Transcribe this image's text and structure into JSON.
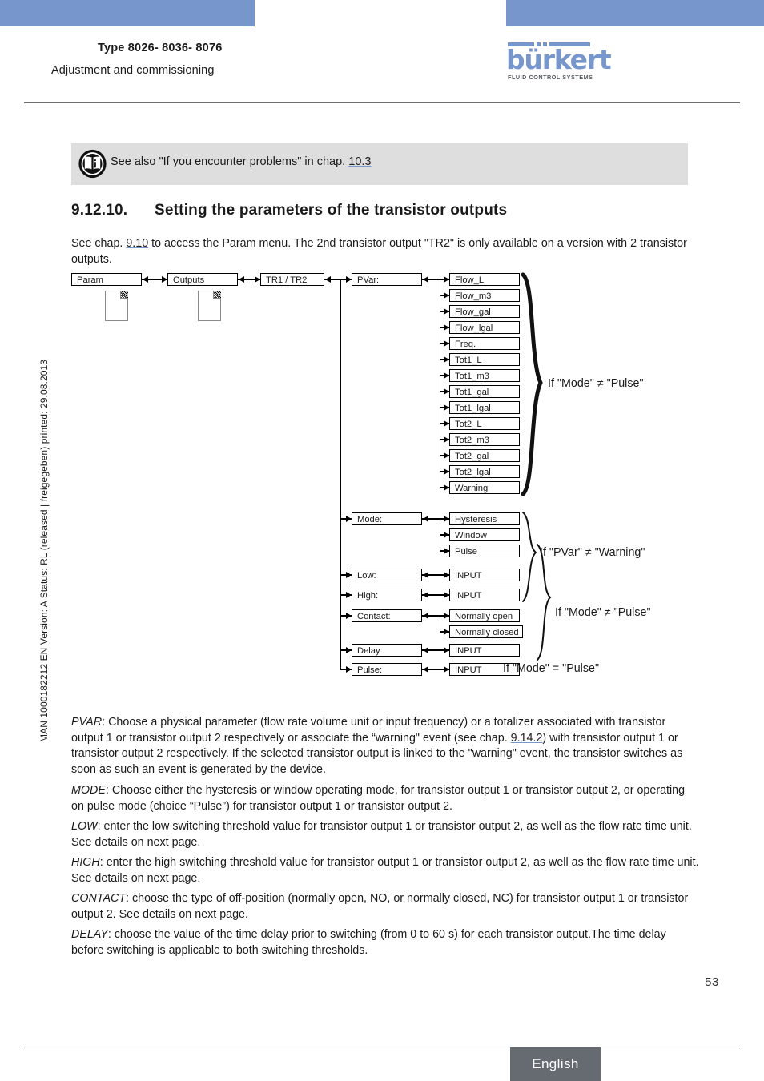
{
  "header": {
    "type_line": "Type 8026- 8036- 8076",
    "subtitle": "Adjustment and commissioning",
    "logo_word": "bürkert",
    "logo_tagline": "FLUID CONTROL SYSTEMS",
    "brand_color": "#7796cc"
  },
  "sidenote": "MAN 1000182212  EN  Version: A  Status: RL (released | freigegeben)  printed: 29.08.2013",
  "note": {
    "icon": "book-info-icon",
    "text_before": "See also \"If you encounter problems\" in chap. ",
    "link": "10.3"
  },
  "heading": {
    "number": "9.12.10.",
    "title": "Setting the parameters of the transistor outputs"
  },
  "intro": {
    "part1": "See chap. ",
    "link": "9.10",
    "part2": " to access the Param menu. The 2nd transistor output \"TR2\" is only available on a version with 2 transistor outputs."
  },
  "diagram": {
    "menu_path": [
      {
        "label": "Param"
      },
      {
        "label": "Outputs"
      },
      {
        "label": "TR1 / TR2"
      }
    ],
    "page_icons": [
      "page-icon-param",
      "page-icon-outputs"
    ],
    "params": [
      {
        "label": "PVar:"
      },
      {
        "label": "Mode:"
      },
      {
        "label": "Low:"
      },
      {
        "label": "High:"
      },
      {
        "label": "Contact:"
      },
      {
        "label": "Delay:"
      },
      {
        "label": "Pulse:"
      }
    ],
    "pvar_options": [
      "Flow_L",
      "Flow_m3",
      "Flow_gal",
      "Flow_lgal",
      "Freq.",
      "Tot1_L",
      "Tot1_m3",
      "Tot1_gal",
      "Tot1_lgal",
      "Tot2_L",
      "Tot2_m3",
      "Tot2_gal",
      "Tot2_lgal",
      "Warning"
    ],
    "mode_options": [
      "Hysteresis",
      "Window",
      "Pulse"
    ],
    "low_option": "INPUT",
    "high_option": "INPUT",
    "contact_options": [
      "Normally open",
      "Normally closed"
    ],
    "delay_option": "INPUT",
    "pulse_option": "INPUT",
    "conditions": {
      "pvar_brace": "If \"Mode\" ≠ \"Pulse\"",
      "mode_brace": "If \"PVar\" ≠ \"Warning\"",
      "group_brace": "If \"Mode\" ≠ \"Pulse\"",
      "pulse_label": "If \"Mode\" = \"Pulse\""
    }
  },
  "body": {
    "pvar": "PVAR: Choose a physical parameter (flow rate volume unit or input frequency) or a totalizer associated with transistor output 1 or transistor output 2 respectively or associate the “warning\" event (see chap. 9.14.2) with transistor output 1 or transistor output 2 respectively. If the selected transistor output is linked to the \"warning\" event, the transistor switches as soon as such an event is generated by the device.",
    "pvar_label": "PVAR",
    "pvar_t1": ": Choose a physical parameter (flow rate volume unit or input frequency) or a totalizer associated with transistor output 1 or transistor output 2 respectively or associate the “warning\" event (see chap. ",
    "pvar_link": "9.14.2",
    "pvar_t2": ") with transistor output 1 or transistor output 2 respectively. If the selected transistor output is linked to the \"warning\" event, the transistor switches as soon as such an event is generated by the device.",
    "mode_label": "MODE",
    "mode_text": ": Choose either the hysteresis or window operating mode, for transistor output 1 or transistor output 2, or operating on pulse mode (choice “Pulse”) for transistor output 1 or transistor output 2.",
    "low_label": "LOW",
    "low_text": ": enter the low switching threshold value for transistor output 1 or transistor output 2, as well as the flow rate time unit. See details on next page.",
    "high_label": "HIGH",
    "high_text": ": enter the high switching threshold value for transistor output 1 or transistor output 2, as well as the flow rate time unit. See details on next page.",
    "contact_label": "CONTACT",
    "contact_text": ": choose the type of off-position (normally open, NO, or normally closed, NC) for transistor output 1 or transistor output 2. See details on next page.",
    "delay_label": "DELAY",
    "delay_text": ": choose the value of the time delay prior to switching (from 0 to 60 s) for each transistor output.The time delay before switching is applicable to both switching thresholds."
  },
  "footer": {
    "page_number": "53",
    "language_tab": "English"
  }
}
